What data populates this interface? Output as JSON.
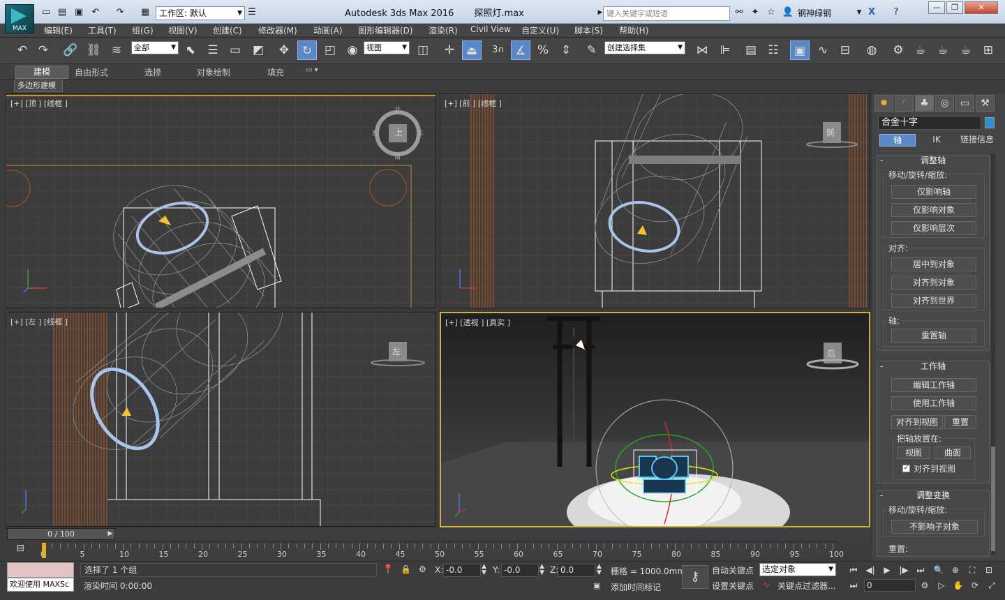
{
  "app": {
    "title": "Autodesk 3ds Max 2016",
    "file": "探照灯.max",
    "logo_text": "MAX",
    "workspace": "工作区: 默认",
    "search_placeholder": "键入关键字或短语",
    "user": "钢神绿钢"
  },
  "menu": [
    "编辑(E)",
    "工具(T)",
    "组(G)",
    "视图(V)",
    "创建(C)",
    "修改器(M)",
    "动画(A)",
    "图形编辑器(D)",
    "渲染(R)",
    "Civil View",
    "自定义(U)",
    "脚本(S)",
    "帮助(H)"
  ],
  "toolbar": {
    "selection_filter": "全部",
    "ref_coord": "视图",
    "snap_angle": "3",
    "named_selection": "创建选择集"
  },
  "ribbon": {
    "tabs": [
      "建模",
      "自由形式",
      "选择",
      "对象绘制",
      "填充"
    ],
    "active_tab": "建模",
    "sub": "多边形建模"
  },
  "viewports": {
    "top": "[+] [顶 ] [线框 ]",
    "front": "[+] [前 ] [线框 ]",
    "left": "[+] [左 ] [线框 ]",
    "persp": "[+] [透视 ] [真实 ]",
    "cube_top": "上",
    "cube_front": "前",
    "cube_left": "左",
    "cube_persp": "后",
    "compass": [
      "北",
      "东",
      "南",
      "西"
    ]
  },
  "command_panel": {
    "object_name": "合金十字",
    "object_color": "#2f8fd3",
    "hier_tabs": [
      "轴",
      "IK",
      "链接信息"
    ],
    "active_hier": "轴",
    "adjust_pivot": {
      "title": "调整轴",
      "move_group": "移动/旋转/缩放:",
      "btn_pivot_only": "仅影响轴",
      "btn_object_only": "仅影响对象",
      "btn_hierarchy_only": "仅影响层次",
      "align_group": "对齐:",
      "btn_center": "居中到对象",
      "btn_align_obj": "对齐到对象",
      "btn_align_world": "对齐到世界",
      "pivot_group": "轴:",
      "btn_reset": "重置轴"
    },
    "working_pivot": {
      "title": "工作轴",
      "btn_edit": "编辑工作轴",
      "btn_use": "使用工作轴",
      "btn_align_view": "对齐到视图",
      "btn_reset": "重置",
      "place_group": "把轴放置在:",
      "btn_view": "视图",
      "btn_surface": "曲面",
      "chk_align_view": "对齐到视图"
    },
    "adjust_transform": {
      "title": "调整变换",
      "move_group": "移动/旋转/缩放:",
      "btn_dont_affect": "不影响子对象",
      "reset_group": "重置:"
    }
  },
  "timeline": {
    "slider": "0 / 100",
    "ticks": [
      "0",
      "5",
      "10",
      "15",
      "20",
      "25",
      "30",
      "35",
      "40",
      "45",
      "50",
      "55",
      "60",
      "65",
      "70",
      "75",
      "80",
      "85",
      "90",
      "95",
      "100"
    ]
  },
  "status": {
    "welcome": "欢迎使用 MAXSc",
    "selected": "选择了 1 个组",
    "render_time": "渲染时间 0:00:00",
    "x": "-0.0",
    "y": "-0.0",
    "z": "0.0",
    "x_label": "X:",
    "y_label": "Y:",
    "z_label": "Z:",
    "grid": "栅格 = 1000.0mm",
    "add_time_tag": "添加时间标记",
    "auto_key": "自动关键点",
    "set_key": "设置关键点",
    "key_mode": "选定对象",
    "key_filters": "关键点过滤器...",
    "frame": "0"
  }
}
